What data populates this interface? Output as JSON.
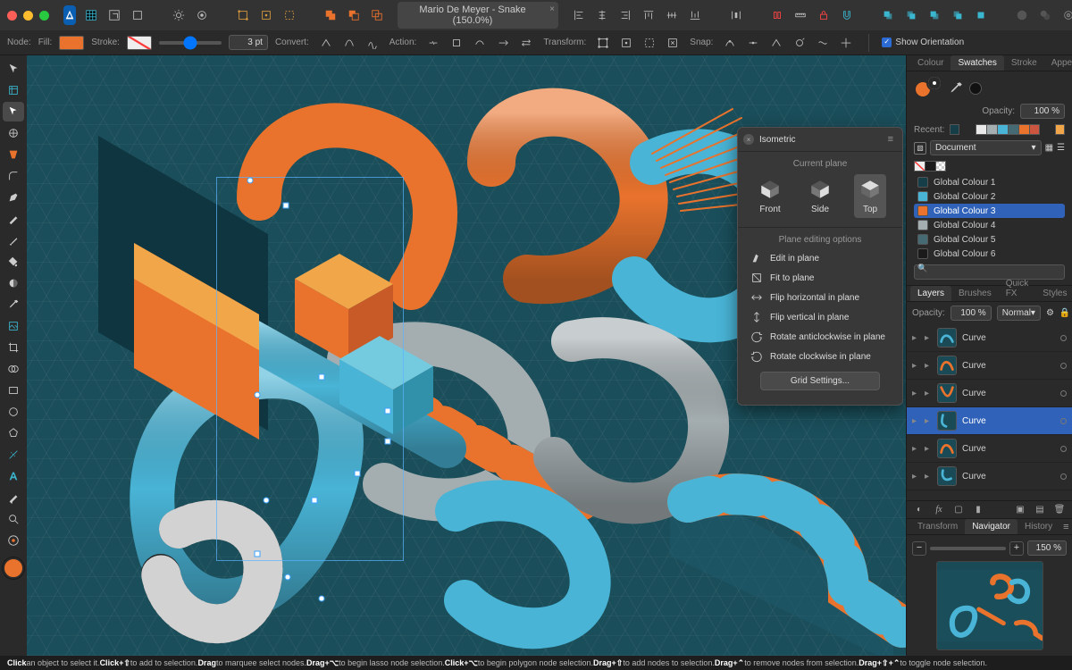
{
  "app": {
    "doc_title": "Mario De Meyer - Snake (150.0%)"
  },
  "contextbar": {
    "node_label": "Node:",
    "fill_label": "Fill:",
    "stroke_label": "Stroke:",
    "stroke_pt": "3 pt",
    "convert_label": "Convert:",
    "action_label": "Action:",
    "transform_label": "Transform:",
    "snap_label": "Snap:",
    "show_orientation_label": "Show Orientation"
  },
  "iso": {
    "title": "Isometric",
    "current_plane_label": "Current plane",
    "front": "Front",
    "side": "Side",
    "top": "Top",
    "editing_options_label": "Plane editing options",
    "opts": [
      "Edit in plane",
      "Fit to plane",
      "Flip horizontal in plane",
      "Flip vertical in plane",
      "Rotate anticlockwise in plane",
      "Rotate clockwise in plane"
    ],
    "grid_settings": "Grid Settings..."
  },
  "swatches": {
    "tabs": [
      "Colour",
      "Swatches",
      "Stroke",
      "Appearance"
    ],
    "opacity_label": "Opacity:",
    "opacity_value": "100 %",
    "recent_label": "Recent:",
    "dropdown": "Document",
    "items": [
      {
        "name": "Global Colour 1",
        "cls": "bsw-dk"
      },
      {
        "name": "Global Colour 2",
        "cls": "bsw-blue"
      },
      {
        "name": "Global Colour 3",
        "cls": "bsw-orange"
      },
      {
        "name": "Global Colour 4",
        "cls": "bsw-gry"
      },
      {
        "name": "Global Colour 5",
        "cls": "bsw-mid"
      },
      {
        "name": "Global Colour 6",
        "cls": "bsw-blk"
      }
    ],
    "selected_index": 2
  },
  "layers": {
    "tabs": [
      "Layers",
      "Brushes",
      "Quick FX",
      "Styles"
    ],
    "opacity_label": "Opacity:",
    "opacity_value": "100 %",
    "blend": "Normal",
    "rows": [
      {
        "name": "Curve"
      },
      {
        "name": "Curve"
      },
      {
        "name": "Curve"
      },
      {
        "name": "Curve",
        "selected": true
      },
      {
        "name": "Curve"
      },
      {
        "name": "Curve"
      }
    ]
  },
  "navigator": {
    "tabs": [
      "Transform",
      "Navigator",
      "History"
    ],
    "zoom": "150 %"
  },
  "statusbar": {
    "segments": [
      {
        "b": "Click"
      },
      {
        "t": " an object to select it. "
      },
      {
        "b": "Click+⇧"
      },
      {
        "t": " to add to selection. "
      },
      {
        "b": "Drag"
      },
      {
        "t": " to marquee select nodes. "
      },
      {
        "b": "Drag+⌥"
      },
      {
        "t": " to begin lasso node selection. "
      },
      {
        "b": "Click+⌥"
      },
      {
        "t": " to begin polygon node selection. "
      },
      {
        "b": "Drag+⇧"
      },
      {
        "t": " to add nodes to selection. "
      },
      {
        "b": "Drag+⌃"
      },
      {
        "t": " to remove nodes from selection. "
      },
      {
        "b": "Drag+⇧+⌃"
      },
      {
        "t": " to toggle node selection."
      }
    ]
  }
}
